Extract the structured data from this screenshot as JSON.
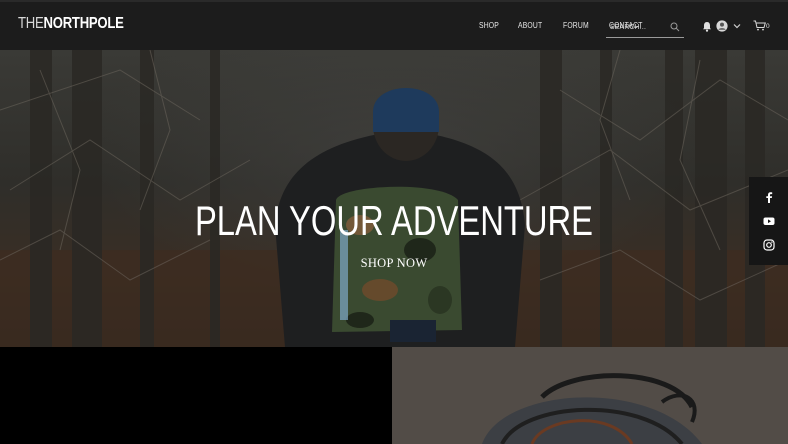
{
  "header": {
    "logo": {
      "part1": "THE",
      "part2": "NORTHPOLE"
    },
    "nav": [
      "SHOP",
      "ABOUT",
      "FORUM",
      "CONTACT"
    ],
    "search_placeholder": "SEARCH...",
    "cart_count": "0"
  },
  "hero": {
    "title": "PLAN YOUR ADVENTURE",
    "cta": "SHOP NOW"
  },
  "social": {
    "icons": [
      "facebook-icon",
      "youtube-icon",
      "instagram-icon"
    ]
  },
  "colors": {
    "header_bg": "#1c1c1c",
    "social_bg": "#161616",
    "text": "#ffffff"
  }
}
